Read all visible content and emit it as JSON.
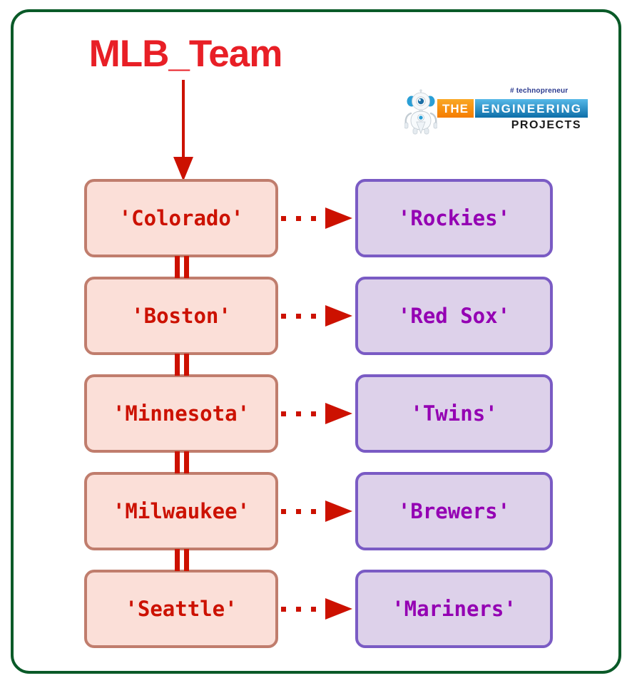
{
  "diagram": {
    "title": "MLB_Team",
    "title_color": "#e81f26",
    "frame_color": "#0a5a28",
    "key_text_color": "#cc1100",
    "value_text_color": "#9400b3",
    "key_box_fill": "#fbdfd8",
    "key_box_border": "#c07d6d",
    "value_box_fill": "#ddd1ea",
    "value_box_border": "#7a5bc4",
    "arrow_color": "#cc1100",
    "type": "dictionary-mapping",
    "pairs": [
      {
        "key": "'Colorado'",
        "value": "'Rockies'"
      },
      {
        "key": "'Boston'",
        "value": "'Red Sox'"
      },
      {
        "key": "'Minnesota'",
        "value": "'Twins'"
      },
      {
        "key": "'Milwaukee'",
        "value": "'Brewers'"
      },
      {
        "key": "'Seattle'",
        "value": "'Mariners'"
      }
    ]
  },
  "logo": {
    "tagline": "# technopreneur",
    "word_the": "THE",
    "word_engineering": "ENGINEERING",
    "word_projects": "PROJECTS",
    "orange": "#f57c00",
    "blue": "#0d6ea8"
  }
}
